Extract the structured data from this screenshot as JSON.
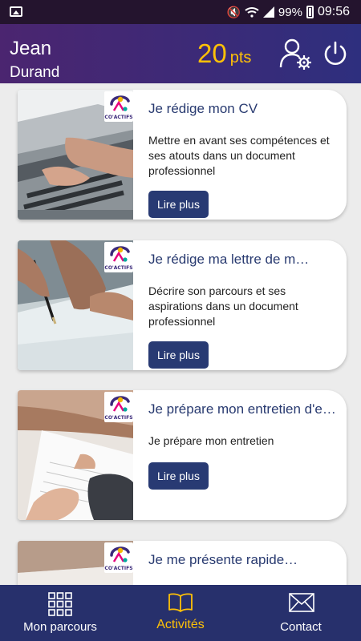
{
  "status_bar": {
    "battery": "99%",
    "time": "09:56",
    "icons": [
      "gallery-icon",
      "mute-icon",
      "wifi-icon",
      "signal-icon",
      "battery-icon"
    ]
  },
  "header": {
    "first_name": "Jean",
    "last_name": "Durand",
    "points_value": "20",
    "points_unit": "pts",
    "icons": [
      "user-settings-icon",
      "power-icon"
    ]
  },
  "brand": {
    "logo_text": "CO'ACTIFS"
  },
  "cards": [
    {
      "title": "Je rédige mon CV",
      "description": "Mettre en avant ses compétences et ses atouts dans un document professionnel",
      "button": "Lire plus"
    },
    {
      "title": "Je rédige ma lettre de m…",
      "description": "Décrire son parcours et ses aspirations dans un document professionnel",
      "button": "Lire plus"
    },
    {
      "title": "Je prépare mon entretien d'e…",
      "description": "Je prépare mon entretien",
      "button": "Lire plus"
    },
    {
      "title": "Je me présente rapide…",
      "description": "",
      "button": ""
    }
  ],
  "bottom_nav": {
    "items": [
      {
        "label": "Mon parcours",
        "icon": "grid-icon",
        "active": false
      },
      {
        "label": "Activités",
        "icon": "book-icon",
        "active": true
      },
      {
        "label": "Contact",
        "icon": "envelope-icon",
        "active": false
      }
    ]
  },
  "colors": {
    "header_gradient_start": "#4b2570",
    "header_gradient_end": "#2e2f7e",
    "points": "#ffc107",
    "nav_bg": "#27306c",
    "nav_active": "#ffc107",
    "button_bg": "#283a73"
  }
}
